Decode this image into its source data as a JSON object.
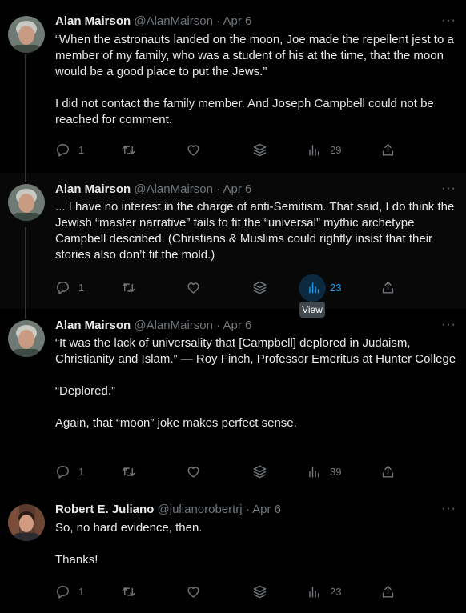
{
  "tweets": [
    {
      "name": "Alan Mairson",
      "handle": "@AlanMairson",
      "date": "Apr 6",
      "paragraphs": [
        "“When the astronauts landed on the moon, Joe made the repellent jest to a member of my family, who was a student of his at the time, that the moon would be a good place to put the Jews.”",
        "I did not contact the family member. And Joseph Campbell could not be reached for comment."
      ],
      "replies": "1",
      "views": "29"
    },
    {
      "name": "Alan Mairson",
      "handle": "@AlanMairson",
      "date": "Apr 6",
      "paragraphs": [
        "... I have no interest in the charge of anti-Semitism. That said, I do think the Jewish “master narrative” fails to fit the “universal” mythic archetype Campbell described. (Christians & Muslims could rightly insist that their stories also don’t fit the mold.)"
      ],
      "replies": "1",
      "views": "23"
    },
    {
      "name": "Alan Mairson",
      "handle": "@AlanMairson",
      "date": "Apr 6",
      "paragraphs": [
        "“It was the lack of universality that [Campbell] deplored in Judaism, Christianity and Islam.” — Roy Finch, Professor Emeritus at Hunter College",
        "“Deplored.”",
        "Again, that “moon” joke makes perfect sense."
      ],
      "replies": "1",
      "views": "39"
    },
    {
      "name": "Robert E. Juliano",
      "handle": "@julianorobertrj",
      "date": "Apr 6",
      "paragraphs": [
        "So, no hard evidence, then.",
        "Thanks!"
      ],
      "replies": "1",
      "views": "23"
    }
  ],
  "separator": "·",
  "more_glyph": "···",
  "tooltip": "View",
  "colors": {
    "background": "#000000",
    "text": "#e7e9ea",
    "muted": "#71767b",
    "accent": "#1d9bf0"
  },
  "icons": [
    "reply-icon",
    "retweet-icon",
    "like-icon",
    "stack-icon",
    "views-icon",
    "share-icon"
  ]
}
